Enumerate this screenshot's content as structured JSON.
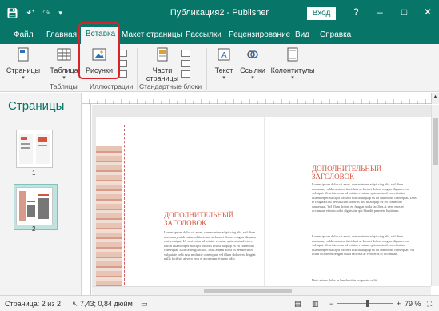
{
  "titlebar": {
    "title": "Публикация2  -  Publisher",
    "signin": "Вход",
    "help": "?",
    "minimize": "–",
    "maximize": "□",
    "close": "✕"
  },
  "tabs": [
    {
      "label": "Файл"
    },
    {
      "label": "Главная"
    },
    {
      "label": "Вставка"
    },
    {
      "label": "Макет страницы"
    },
    {
      "label": "Рассылки"
    },
    {
      "label": "Рецензирование"
    },
    {
      "label": "Вид"
    },
    {
      "label": "Справка"
    }
  ],
  "ribbon": {
    "pages": "Страницы",
    "table": "Таблица",
    "pictures": "Рисунки",
    "parts": "Части",
    "parts2": "страницы",
    "text": "Текст",
    "links": "Ссылки",
    "headers": "Колонтитулы",
    "groups": {
      "tables": "Таблицы",
      "illustrations": "Иллюстрации",
      "blocks": "Стандартные блоки"
    }
  },
  "pages_pane": {
    "title": "Страницы",
    "pages": [
      "1",
      "2"
    ]
  },
  "document": {
    "left_heading": "ДОПОЛНИТЕЛЬНЫЙ ЗАГОЛОВОК",
    "right_heading": "ДОПОЛНИТЕЛЬНЫЙ ЗАГОЛОВОК",
    "left_body": "Lorem ipsum dolor sit amet, consectetuer adipiscing elit, sed diam nonummy nibh euismod tincidunt ut laoreet dolore magna aliquam erat volutpat. Ut wisi enim ad minim veniam, quis nostrud exerci tation ullamcorper suscipit lobortis nisl ut aliquip ex ea commodo consequat. Duis te feugifacilisi. Duis autem dolor in hendrerit in vulputate velit esse molestie consequat, vel illum dolore eu feugiat nulla facilisis at vero eros et accumsan et iusto odio",
    "right_body1": "Lorem ipsum dolor sit amet, consectetuer adipiscing elit, sed diem nonummy nibh euismod tincidunt ut lacreet dolore magna aliguam erat volutpat. Ut wisis enim ad minim veniam, quis nostrud exerci tution ullamcorper suscipit lobortis nisl ut aliquip ex ea commodo consequat. Duis te feugifacilisi per suscipit lobortis nisl ut aliquip ex en commodo consequat. Vel illum dolore eu feugiat nulla facilisis at vero eros et accumsan et iusto odio dignissim qui blandit praesent luptatum.",
    "right_body2": "Lorem ipsum dolor sit amet, consectetuer adipiscing elit, sed diem nonummy nibh euismod tincidunt ut lacreet dolore magna aliguam erat volutpat. Ut wisis enim ad minim veniam, quis nostrud exerci tution ullamcorper suscipit lobortis nisl ut aliquip ex ea commodo consequat. Vel illum dolore eu feugiat nulla facilisis at vero eros et accumsan.",
    "right_body3": "Duis autem dolor in hendrerit in vulputate velit"
  },
  "status": {
    "page": "Страница: 2 из 2",
    "position": "7,43; 0,84 дюйм",
    "zoom_minus": "−",
    "zoom_plus": "+",
    "zoom": "79 %",
    "zoom_level_percent": 79
  },
  "colors": {
    "accent": "#077568",
    "heading": "#d9543f",
    "highlight": "#d9232a"
  }
}
